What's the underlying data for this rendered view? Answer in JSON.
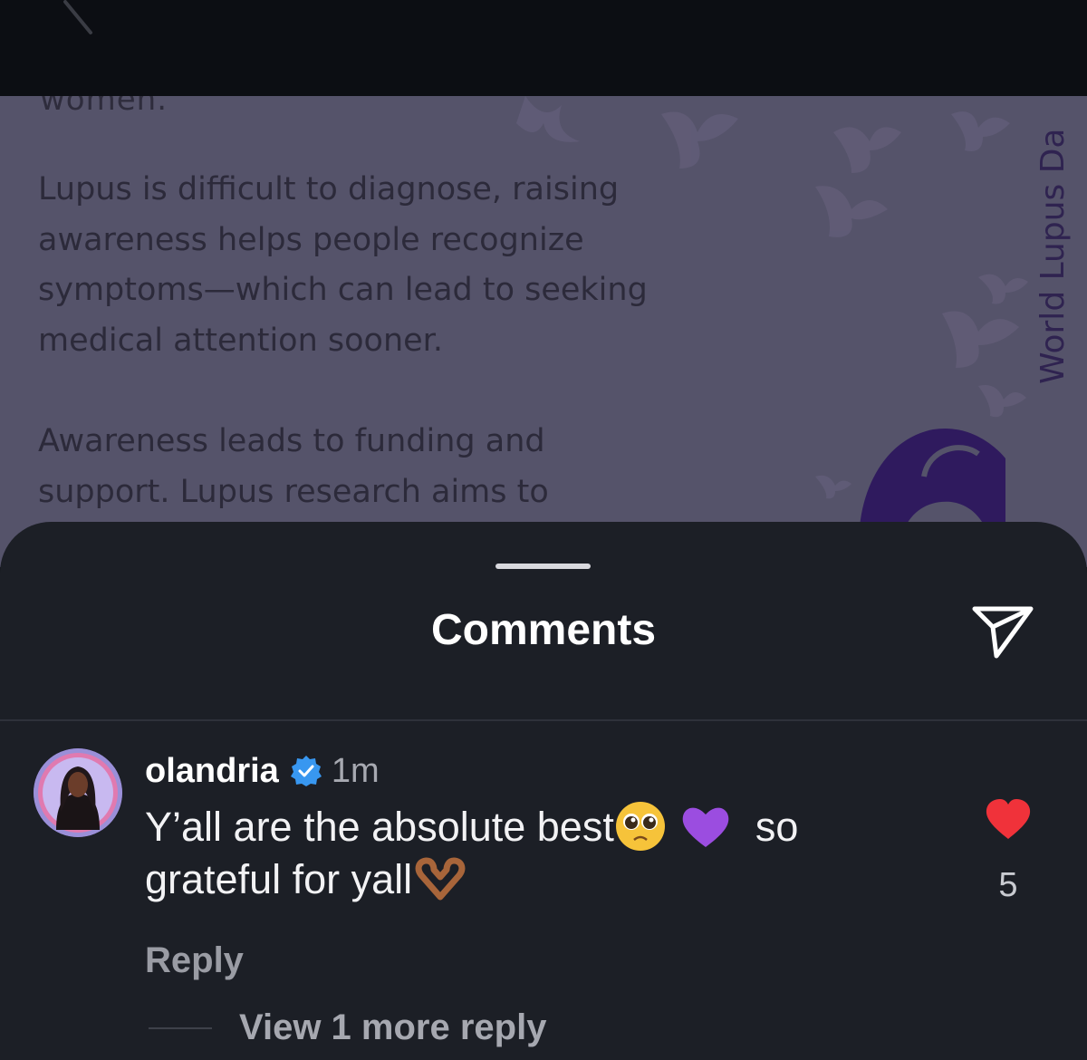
{
  "post": {
    "clipped_line": "women.",
    "paragraph_1": "Lupus is difficult to diagnose, raising\nawareness helps people recognize\nsymptoms—which can lead to seeking\nmedical attention sooner.",
    "paragraph_2": "Awareness leads to funding and\nsupport. Lupus research aims to",
    "banner_text": "World Lupus Da",
    "colors": {
      "background": "#55536a",
      "accent": "#2f1a5e"
    }
  },
  "sheet": {
    "title": "Comments"
  },
  "comment": {
    "username": "olandria",
    "verified": true,
    "timestamp": "1m",
    "text_line_1_before": "Y’all are the absolute best",
    "text_line_1_after": "so",
    "text_line_2": "grateful for yall",
    "emojis": [
      "pleading-face",
      "purple-heart",
      "heart-hands"
    ],
    "reply_label": "Reply",
    "like_count": "5",
    "liked": true,
    "view_replies_label": "View 1 more reply"
  },
  "icons": {
    "back": "back-chevron-icon",
    "share": "share-paper-plane-icon",
    "verified": "verified-badge-icon",
    "like": "heart-icon"
  },
  "colors_ui": {
    "sheet_bg": "#1c1f26",
    "like_red": "#f0323a",
    "verified_blue": "#3897f0"
  }
}
